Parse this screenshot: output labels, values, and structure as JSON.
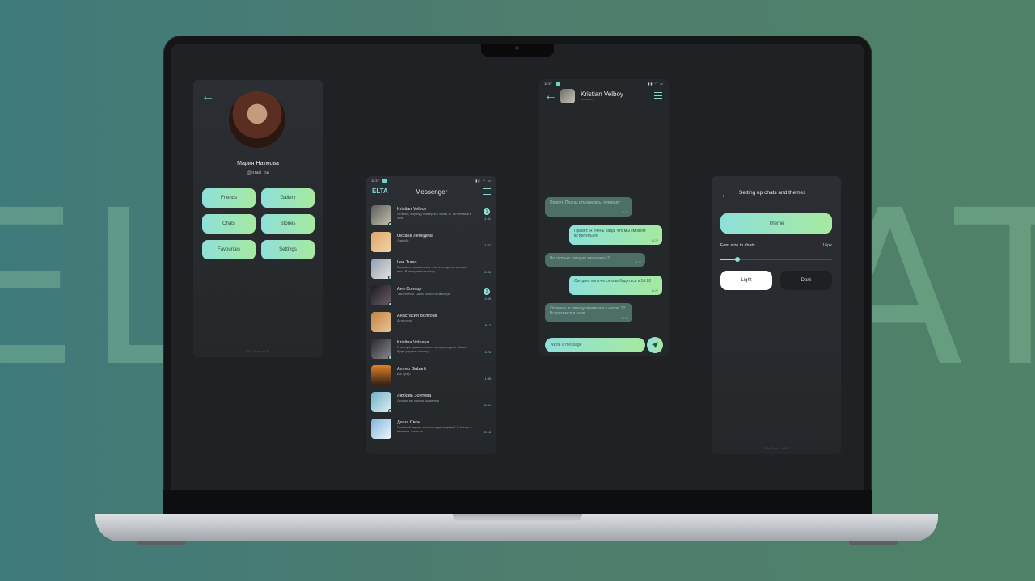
{
  "colors": {
    "accent_teal": "#8ee0d9",
    "accent_green": "#a6e9a0",
    "panel_bg": "#2b2e32",
    "screen_bg": "#1f2124",
    "backdrop": "#4f7d6e"
  },
  "background_text": {
    "left": "EL",
    "right": "AT"
  },
  "profile": {
    "name": "Мария Наумова",
    "handle": "@mari_na",
    "buttons": [
      "Friends",
      "Gallery",
      "Chats",
      "Stories",
      "Favourites",
      "Settings"
    ],
    "footer": "Elta Chat · v1.01"
  },
  "messenger": {
    "status_time": "11:37",
    "status_icons": "▮▮ ◠ ▭",
    "logo": "ELTA",
    "title": "Messenger",
    "chats": [
      {
        "name": "Kristian Velboy",
        "message": "Отлично, я приеду примерно к часам 17. Встретимся в зале",
        "time": "11:31",
        "badge": "1",
        "online": true
      },
      {
        "name": "Оксана Лебедева",
        "message": "Спасибо",
        "time": "11:07",
        "badge": "",
        "online": false
      },
      {
        "name": "Leo Turso",
        "message": "Возможно сначала стоит посетить пару интересных мест. Я свожу тебя на почту...",
        "time": "11:05",
        "badge": "",
        "online": true
      },
      {
        "name": "Аня Солнце",
        "message": "Там отлично. Скинь ссылку на мастера",
        "time": "10:55",
        "badge": "2",
        "online": true
      },
      {
        "name": "Анастасия Волкова",
        "message": "До встречи",
        "time": "8:17",
        "badge": "",
        "online": false
      },
      {
        "name": "Kristina Volnaya",
        "message": "Я вернусь примерно через полторы недели. Можно будет устроить тусовку",
        "time": "5:23",
        "badge": "",
        "online": true
      },
      {
        "name": "Amreo Gabarti",
        "message": "Bull супер",
        "time": "1:35",
        "badge": "",
        "online": false
      },
      {
        "name": "Любовь Зойтова",
        "message": "Сегодня как подали документы",
        "time": "20:34",
        "badge": "",
        "online": true
      },
      {
        "name": "Даша Свон",
        "message": "При какой задачке кого ты тогда говоришь? Я сейчас в магазине, стала ра...",
        "time": "22:15",
        "badge": "",
        "online": false
      }
    ]
  },
  "chat": {
    "status_time": "11:37",
    "contact_name": "Kristian Velboy",
    "contact_status": "печатает...",
    "messages": [
      {
        "dir": "in",
        "text": "Привет. Планы отменились, я приеду",
        "time": "11:20"
      },
      {
        "dir": "out",
        "text": "Привет. Я очень рада, что мы сможем встретиться!",
        "time": "11:22"
      },
      {
        "dir": "in",
        "text": "Во сколько сегодня закончишь?",
        "time": "11:25"
      },
      {
        "dir": "out",
        "text": "Сегодня получится освободиться к 16:20",
        "time": "11:27"
      },
      {
        "dir": "in",
        "text": "Отлично, я приеду примерно к часам 17. Встретимся в зале",
        "time": "11:31"
      }
    ],
    "input_placeholder": "Write a message"
  },
  "settings": {
    "title": "Setting up chats and themes",
    "theme_button": "Theme",
    "font_label": "Font size in chats",
    "font_value": "16px",
    "font_slider_fraction": 0.15,
    "light_label": "Light",
    "dark_label": "Dark",
    "footer": "Elta Chat · v1.01"
  }
}
